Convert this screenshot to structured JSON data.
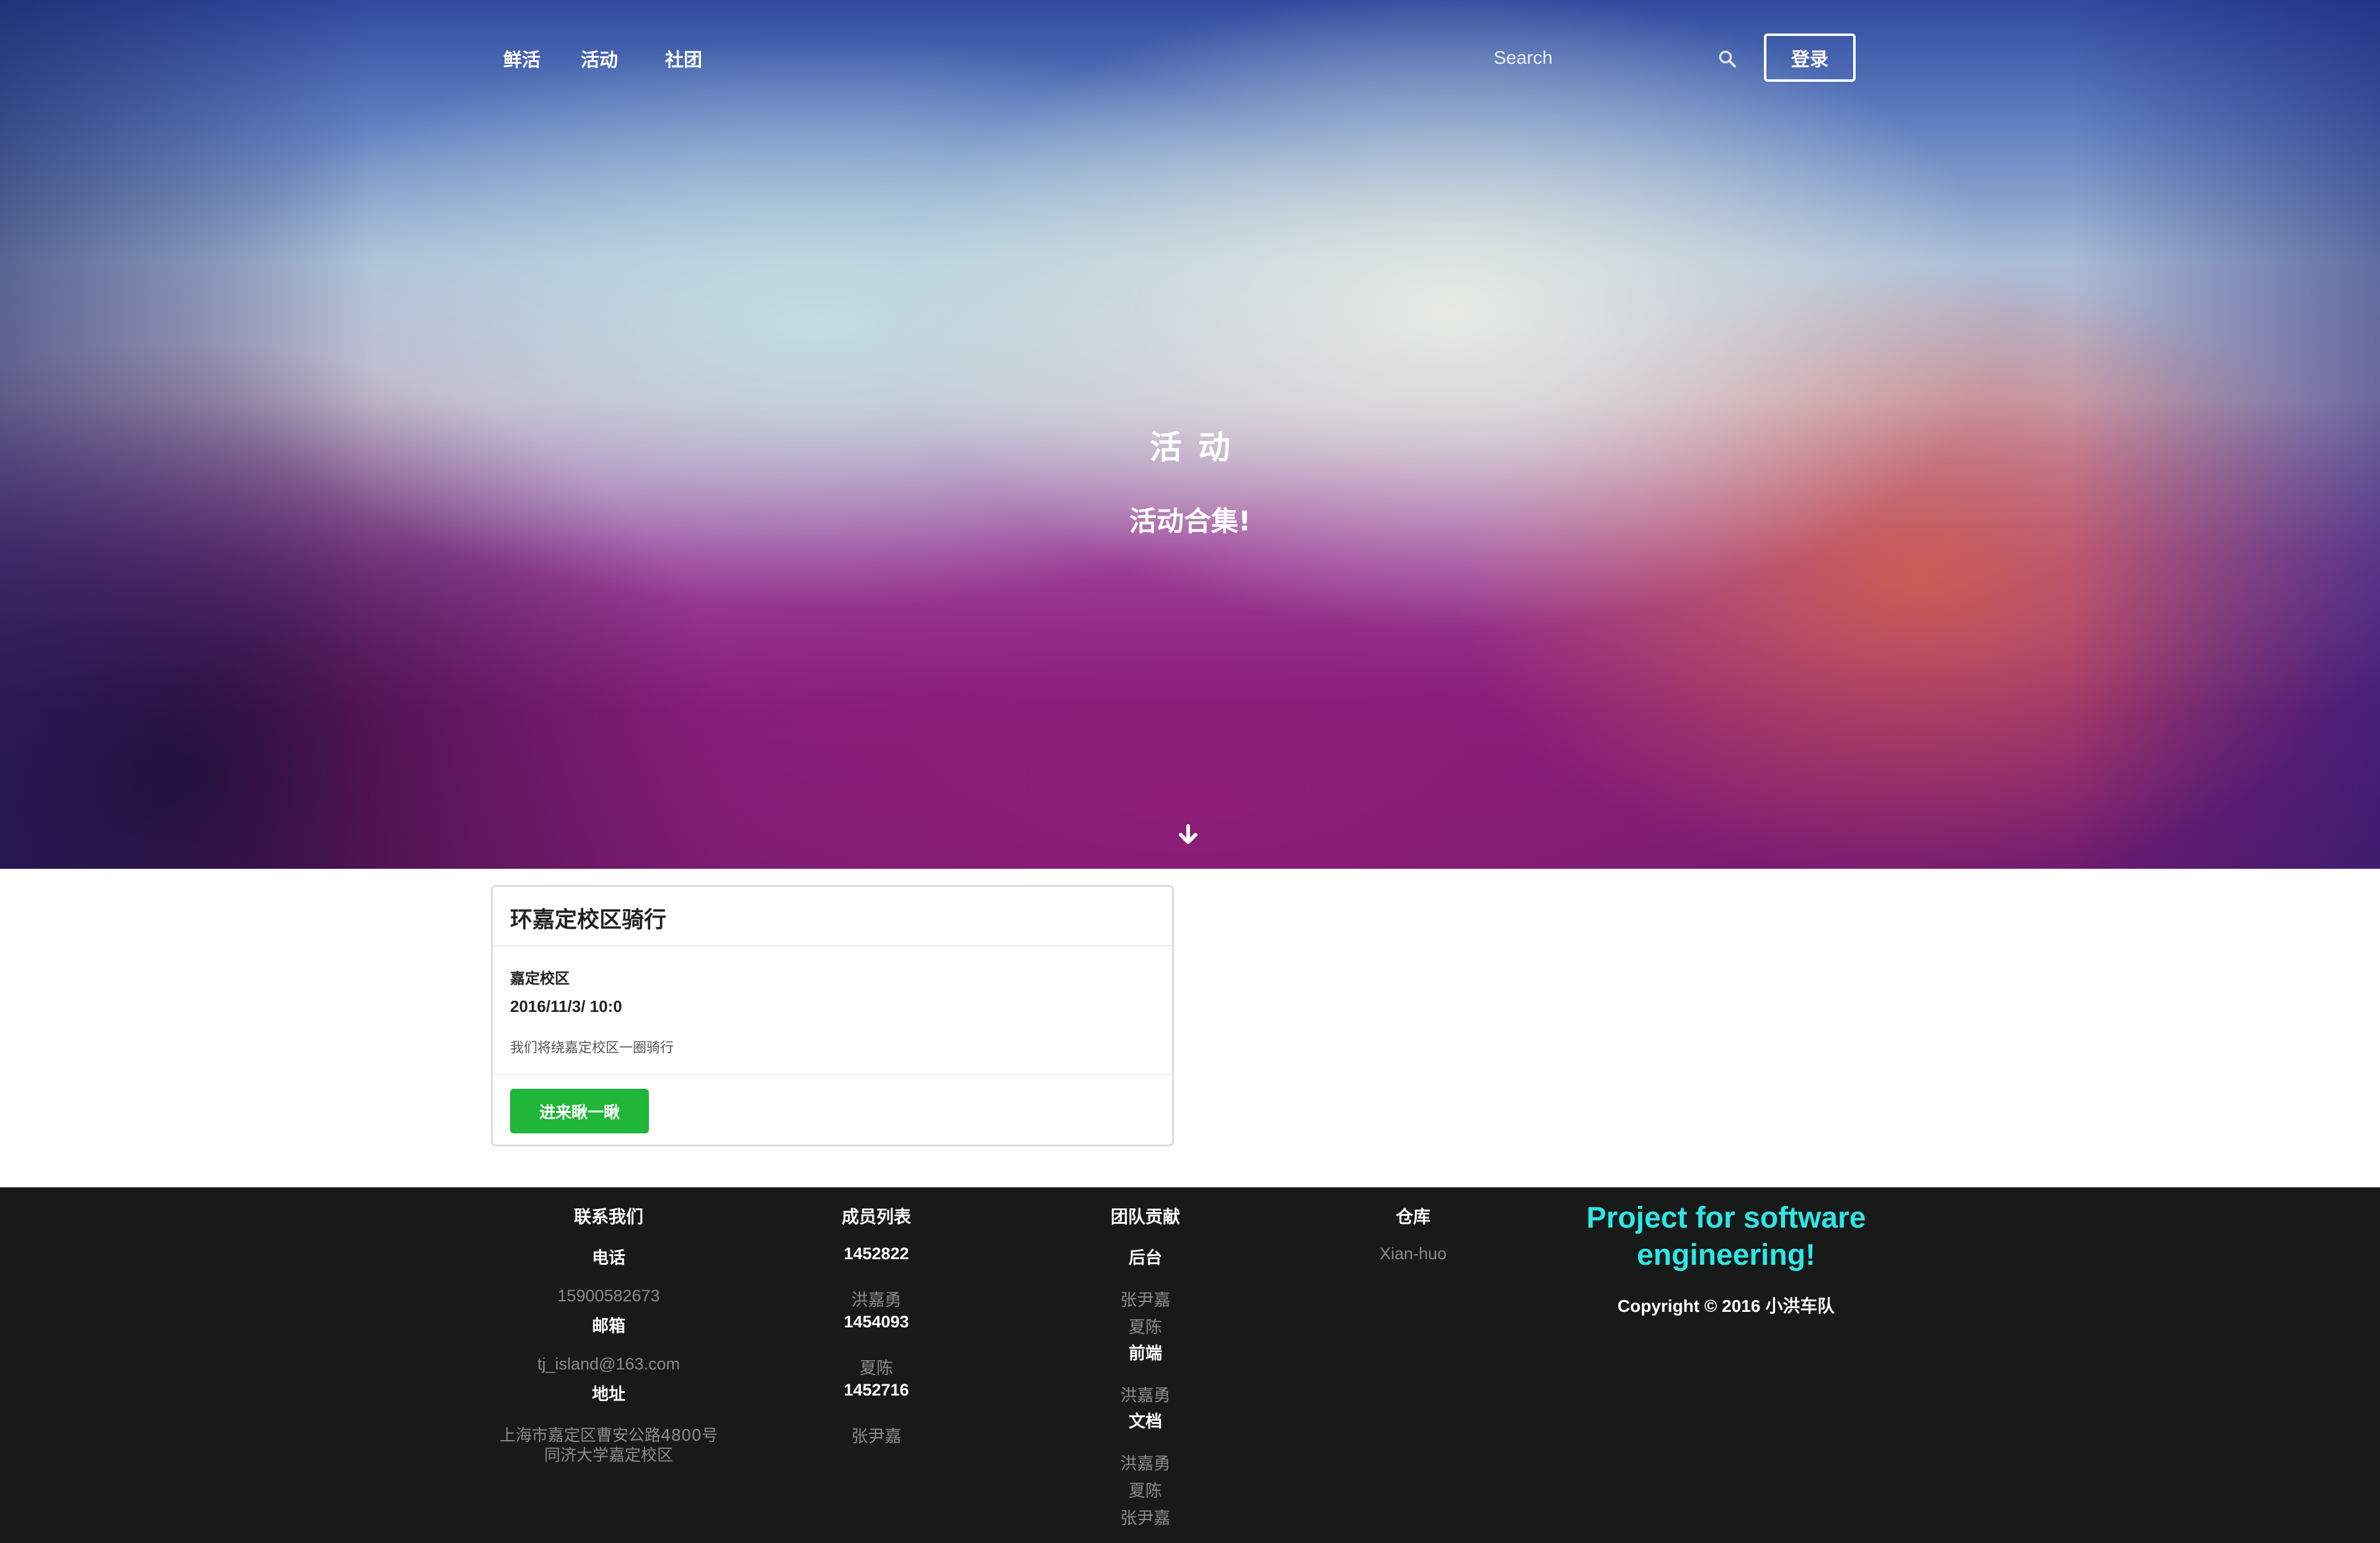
{
  "nav": {
    "items": [
      {
        "label": "鲜活"
      },
      {
        "label": "活动"
      },
      {
        "label": "社团"
      }
    ],
    "search_placeholder": "Search",
    "search_icon": "search-icon",
    "login_label": "登录"
  },
  "hero": {
    "title": "活动",
    "subtitle": "活动合集!",
    "scroll_icon": "arrow-down-icon"
  },
  "activity": {
    "title": "环嘉定校区骑行",
    "campus": "嘉定校区",
    "time": "2016/11/3/ 10:0",
    "description": "我们将绕嘉定校区一圈骑行",
    "button_label": "进来瞅一瞅",
    "button_color": "#1fb63a"
  },
  "footer": {
    "contact": {
      "heading": "联系我们",
      "phone_label": "电话",
      "phone": "15900582673",
      "email_label": "邮箱",
      "email": "tj_island@163.com",
      "address_label": "地址",
      "address_line1": "上海市嘉定区曹安公路4800号",
      "address_line2": "同济大学嘉定校区"
    },
    "members": {
      "heading": "成员列表",
      "list": [
        {
          "id": "1452822",
          "name": "洪嘉勇"
        },
        {
          "id": "1454093",
          "name": "夏陈"
        },
        {
          "id": "1452716",
          "name": "张尹嘉"
        }
      ]
    },
    "contribution": {
      "heading": "团队贡献",
      "groups": [
        {
          "label": "后台",
          "names": [
            "张尹嘉",
            "夏陈"
          ]
        },
        {
          "label": "前端",
          "names": [
            "洪嘉勇"
          ]
        },
        {
          "label": "文档",
          "names": [
            "洪嘉勇",
            "夏陈",
            "张尹嘉"
          ]
        }
      ]
    },
    "repo": {
      "heading": "仓库",
      "link": "Xian-huo"
    },
    "project": "Project for software engineering!",
    "copyright": "Copyright © 2016 小洪车队",
    "accent_color": "#2ee6e6",
    "background_color": "#181a19"
  }
}
